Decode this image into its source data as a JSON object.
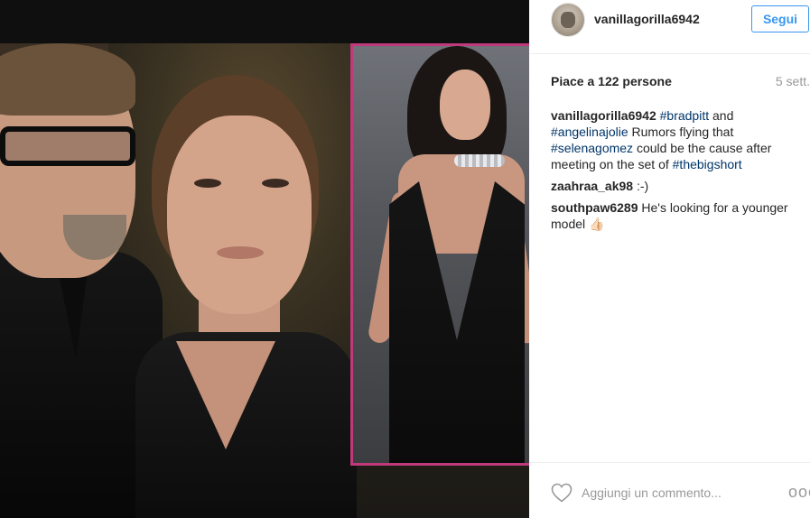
{
  "post": {
    "username": "vanillagorilla6942",
    "follow_label": "Segui",
    "likes_text": "Piace a 122 persone",
    "time_text": "5 sett."
  },
  "caption": {
    "user": "vanillagorilla6942",
    "parts": [
      {
        "text": "#bradpitt",
        "type": "tag"
      },
      {
        "text": " and ",
        "type": "text"
      },
      {
        "text": "#angelinajolie",
        "type": "tag"
      },
      {
        "text": " Rumors flying that ",
        "type": "text"
      },
      {
        "text": "#selenagomez",
        "type": "tag"
      },
      {
        "text": " could be the cause after meeting on the set of ",
        "type": "text"
      },
      {
        "text": "#thebigshort",
        "type": "tag"
      }
    ]
  },
  "comments": [
    {
      "user": "zaahraa_ak98",
      "text": ":-)"
    },
    {
      "user": "southpaw6289",
      "text": "He's looking for a younger model 👍🏻"
    }
  ],
  "footer": {
    "comment_placeholder": "Aggiungi un commento...",
    "more_glyph": "ooo",
    "heart_icon": "heart-outline-icon"
  },
  "colors": {
    "follow_blue": "#3897f0",
    "hashtag_blue": "#003569",
    "muted_gray": "#999999",
    "inset_border": "#c0397a"
  }
}
